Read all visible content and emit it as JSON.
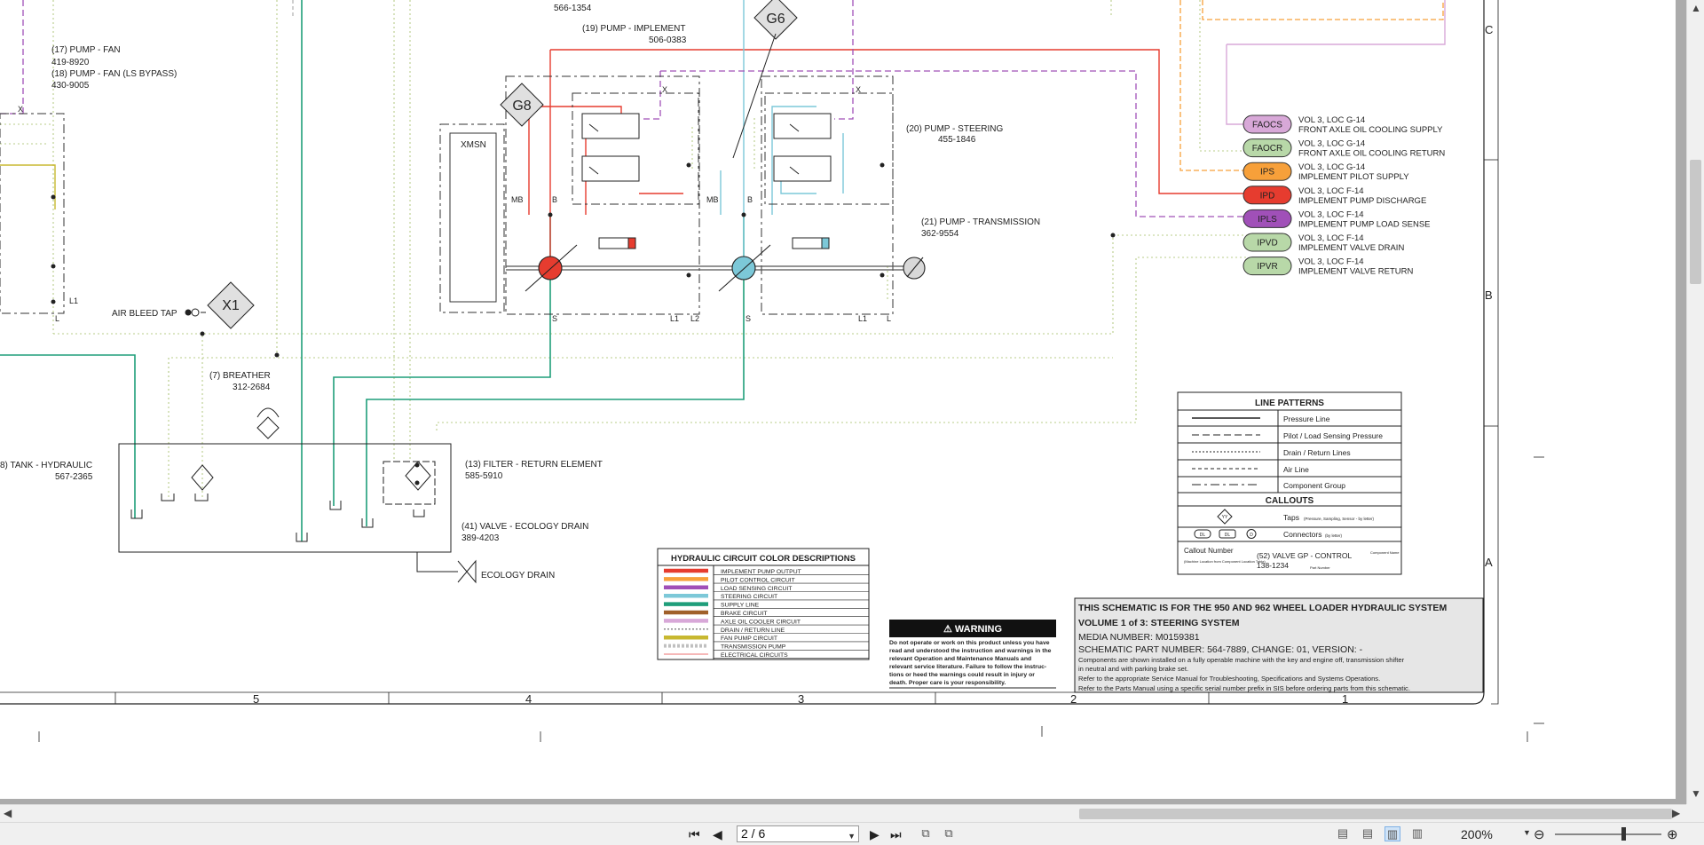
{
  "schematic": {
    "grid_columns": [
      "5",
      "4",
      "3",
      "2",
      "1"
    ],
    "grid_rows": [
      "C",
      "B",
      "A"
    ],
    "components": {
      "pump_fan": {
        "name": "(17) PUMP - FAN",
        "part": "419-8920"
      },
      "pump_fan_bypass": {
        "name": "(18) PUMP - FAN (LS BYPASS)",
        "part": "430-9005"
      },
      "pump_implement": {
        "name": "(19) PUMP - IMPLEMENT",
        "part": "506-0383"
      },
      "top_part": "566-1354",
      "pump_steering": {
        "name": "(20) PUMP - STEERING",
        "part": "455-1846"
      },
      "pump_transmission": {
        "name": "(21) PUMP - TRANSMISSION",
        "part": "362-9554"
      },
      "breather": {
        "name": "(7) BREATHER",
        "part": "312-2684"
      },
      "tank": {
        "name": "8) TANK - HYDRAULIC",
        "part": "567-2365"
      },
      "filter": {
        "name": "(13) FILTER - RETURN ELEMENT",
        "part": "585-5910"
      },
      "valve_drain": {
        "name": "(41) VALVE - ECOLOGY DRAIN",
        "part": "389-4203"
      },
      "ecology_drain": "ECOLOGY DRAIN",
      "air_bleed": "AIR BLEED TAP",
      "xmsn": "XMSN"
    },
    "callouts": [
      "G8",
      "G6",
      "X1"
    ],
    "port_labels": {
      "x": "X",
      "mb": "MB",
      "b": "B",
      "s": "S",
      "l": "L",
      "l1": "L1",
      "l2": "L2"
    },
    "connectors": [
      {
        "code": "FAOCS",
        "color": "#d8a8d8",
        "line1": "VOL 3, LOC G-14",
        "line2": "FRONT AXLE OIL COOLING SUPPLY"
      },
      {
        "code": "FAOCR",
        "color": "#b8d8a8",
        "line1": "VOL 3, LOC G-14",
        "line2": "FRONT AXLE OIL COOLING RETURN"
      },
      {
        "code": "IPS",
        "color": "#f7a03a",
        "line1": "VOL 3, LOC G-14",
        "line2": "IMPLEMENT PILOT SUPPLY"
      },
      {
        "code": "IPD",
        "color": "#e63c2f",
        "line1": "VOL 3, LOC F-14",
        "line2": "IMPLEMENT PUMP DISCHARGE"
      },
      {
        "code": "IPLS",
        "color": "#a050b8",
        "line1": "VOL 3, LOC F-14",
        "line2": "IMPLEMENT PUMP LOAD SENSE"
      },
      {
        "code": "IPVD",
        "color": "#b8d8a8",
        "line1": "VOL 3, LOC F-14",
        "line2": "IMPLEMENT VALVE DRAIN"
      },
      {
        "code": "IPVR",
        "color": "#b8d8a8",
        "line1": "VOL 3, LOC F-14",
        "line2": "IMPLEMENT VALVE RETURN"
      }
    ],
    "line_patterns": {
      "title": "LINE PATTERNS",
      "items": [
        "Pressure Line",
        "Pilot / Load Sensing Pressure",
        "Drain / Return Lines",
        "Air Line",
        "Component Group"
      ],
      "callouts_title": "CALLOUTS",
      "taps": "Taps",
      "taps_note": "(Pressure, Sampling, Sensor - by letter)",
      "connectors": "Connectors",
      "connectors_note": "(by letter)",
      "connector_symbols": [
        "DL",
        "DL",
        "D"
      ],
      "tap_symbol": "YY",
      "callout_number": "Callout Number",
      "callout_loc_note": "(Machine Location from Component Location Table)",
      "example_component": "(52) VALVE GP - CONTROL",
      "example_part": "138-1234",
      "component_name": "Component Name",
      "part_number": "Part Number"
    },
    "color_desc": {
      "title": "HYDRAULIC CIRCUIT COLOR DESCRIPTIONS",
      "items": [
        {
          "label": "IMPLEMENT PUMP OUTPUT",
          "color": "#e63c2f",
          "style": "solid"
        },
        {
          "label": "PILOT CONTROL CIRCUIT",
          "color": "#f7a03a",
          "style": "solid"
        },
        {
          "label": "LOAD SENSING CIRCUIT",
          "color": "#a050b8",
          "style": "solid"
        },
        {
          "label": "STEERING CIRCUIT",
          "color": "#7cc8d8",
          "style": "solid"
        },
        {
          "label": "SUPPLY LINE",
          "color": "#1f9e7a",
          "style": "solid"
        },
        {
          "label": "BRAKE CIRCUIT",
          "color": "#a0602a",
          "style": "solid"
        },
        {
          "label": "AXLE OIL COOLER CIRCUIT",
          "color": "#d8a8d8",
          "style": "solid"
        },
        {
          "label": "DRAIN / RETURN LINE",
          "color": "#b8d8a8",
          "style": "dotted"
        },
        {
          "label": "FAN PUMP CIRCUIT",
          "color": "#c8b830",
          "style": "solid"
        },
        {
          "label": "TRANSMISSION PUMP",
          "color": "#c0c0c0",
          "style": "hatched"
        },
        {
          "label": "ELECTRICAL CIRCUITS",
          "color": "#f4a0a0",
          "style": "thin"
        }
      ]
    },
    "warning": {
      "title": "WARNING",
      "text": [
        "Do not operate or work on this product unless you have",
        "read and understood the instruction and warnings in the",
        "relevant Operation and Maintenance Manuals and",
        "relevant service literature. Failure to follow the instruc-",
        "tions or heed the warnings could result in injury or",
        "death. Proper care is your responsibility."
      ]
    },
    "title_block": {
      "line1": "THIS SCHEMATIC IS FOR THE 950 AND 962 WHEEL LOADER HYDRAULIC SYSTEM",
      "line2": "VOLUME 1 of 3: STEERING SYSTEM",
      "media": "MEDIA NUMBER: M0159381",
      "part": "SCHEMATIC PART NUMBER: 564-7889, CHANGE: 01, VERSION: -",
      "note1": "Components are shown installed on a fully operable machine with the key and engine off, transmission shifter",
      "note2": "in neutral and with parking brake set.",
      "note3": "Refer to the appropriate Service Manual for Troubleshooting, Specifications and Systems Operations.",
      "note4": "Refer to the Parts Manual using a specific serial number prefix in SIS before ordering parts from this schematic."
    }
  },
  "viewer": {
    "page_indicator": "2 / 6",
    "zoom": "200%",
    "nav": {
      "first": "⏮",
      "prev": "◀",
      "next": "▶",
      "last": "⏭"
    }
  }
}
